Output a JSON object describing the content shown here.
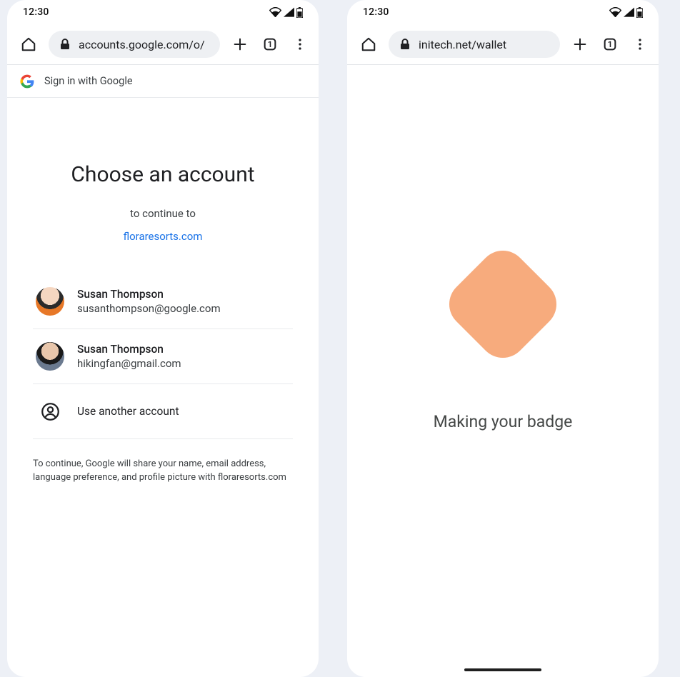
{
  "status": {
    "time": "12:30"
  },
  "left": {
    "url": "accounts.google.com/o/",
    "gis_label": "Sign in with Google",
    "title": "Choose an account",
    "subtitle": "to continue to",
    "rp": "floraresorts.com",
    "accounts": [
      {
        "name": "Susan Thompson",
        "email": "susanthompson@google.com"
      },
      {
        "name": "Susan Thompson",
        "email": "hikingfan@gmail.com"
      }
    ],
    "another": "Use another account",
    "disclosure": "To continue, Google will share your name, email address, language preference, and profile picture with floraresorts.com"
  },
  "right": {
    "url": "initech.net/wallet",
    "message": "Making your badge"
  },
  "tab_count": "1"
}
